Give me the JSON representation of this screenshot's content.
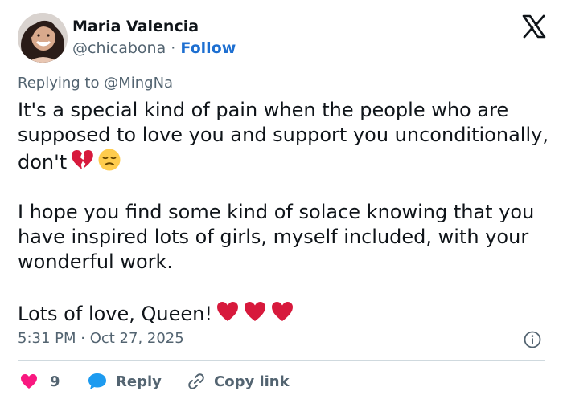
{
  "author": {
    "display_name": "Maria Valencia",
    "handle": "@chicabona",
    "separator": "·",
    "follow_label": "Follow"
  },
  "replying": {
    "prefix": "Replying to",
    "mention": "@MingNa"
  },
  "tweet": {
    "para1": "It's a special kind of pain when the people who are supposed to love you and support you unconditionally, don't",
    "para2": "I hope you find some kind of solace knowing that you have inspired lots of girls, myself included, with your wonderful work.",
    "para3": "Lots of love, Queen!",
    "emoji_after_para1": [
      "broken-heart-icon",
      "disappointed-face-icon"
    ],
    "emoji_after_para3": [
      "red-heart-icon",
      "red-heart-icon",
      "red-heart-icon"
    ]
  },
  "timestamp": "5:31 PM · Oct 27, 2025",
  "actions": {
    "like_count": "9",
    "reply_label": "Reply",
    "copy_label": "Copy link"
  },
  "colors": {
    "follow": "#1d6fd1",
    "secondary_text": "#536471",
    "like_heart": "#f91880",
    "reply_bubble": "#1d9bf0",
    "divider": "#cfd9de"
  }
}
